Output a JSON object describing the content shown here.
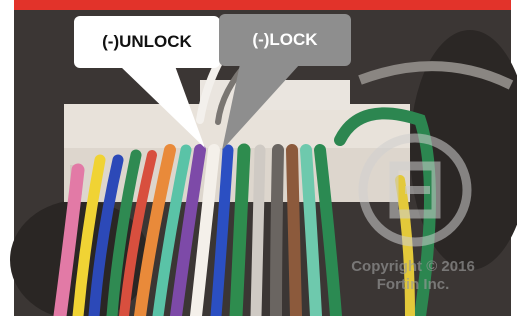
{
  "labels": {
    "unlock": "(-)UNLOCK",
    "lock": "(-)LOCK"
  },
  "watermark": {
    "copyright_line": "Copyright © 2016",
    "brand_line": "Fortin Inc."
  },
  "colors": {
    "top_bar": "#e2332a",
    "unlock_callout": "#ffffff",
    "lock_callout": "#8e8e8e",
    "background": "#3a3533"
  }
}
